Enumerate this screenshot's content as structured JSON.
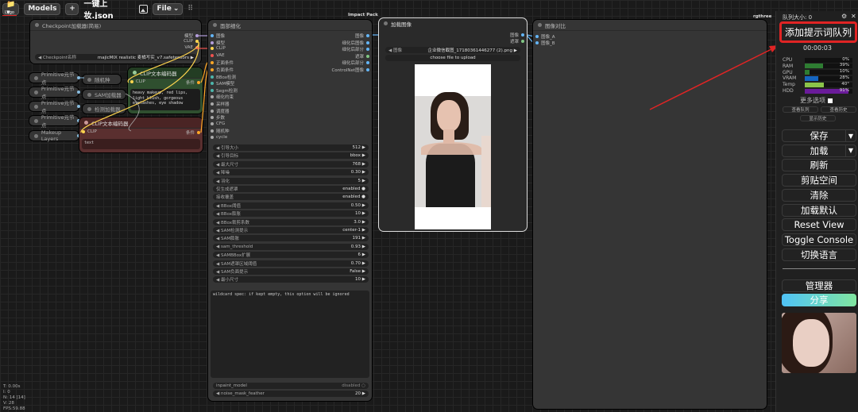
{
  "topbar": {
    "folder_label": "📁▾",
    "models_label": "Models",
    "add_label": "+",
    "workflow_title": "一键上妆.json",
    "image_icon": "image-icon",
    "file_label": "File",
    "more_label": "⠿",
    "corner_label": "Logo"
  },
  "groups": {
    "impact_pack": "Impact Pack",
    "rgthree": "rgthree"
  },
  "checkpoint_node": {
    "title": "Checkpoint加载器(简易)",
    "outputs": [
      "模型",
      "CLIP",
      "VAE"
    ],
    "ckpt_label": "Checkpoint名称",
    "ckpt_value": "majicMIX realistic 麦橘写实_v7.safetensors"
  },
  "primitives": [
    "Primitive元节点",
    "Primitive元节点",
    "Primitive元节点",
    "Primitive元节点",
    "Makeup Layers"
  ],
  "subnodes": {
    "ckpt_sub": "随机种",
    "sam_sub": "SAM加载器",
    "detector_sub": "检测加载器"
  },
  "clip_node_1": {
    "title": "CLIP文本编码器",
    "input": "CLIP",
    "output": "条件",
    "text": "heavy makeup, red lips, light blush, gorgeous eyelashes, eye shadow"
  },
  "clip_node_2": {
    "title": "CLIP文本编码器",
    "input": "CLIP",
    "output": "条件",
    "text": "text"
  },
  "detailer": {
    "title": "面部细化",
    "inputs": [
      "图像",
      "模型",
      "CLIP",
      "VAE",
      "正面条件",
      "负面条件",
      "BBox检测",
      "SAM模型",
      "Segm检测",
      "细化约束",
      "采样器",
      "调度器",
      "步数",
      "CFG",
      "随机种",
      "cycle"
    ],
    "outputs": [
      "图像",
      "细化后图像",
      "细化后部分",
      "遮罩",
      "细化后部分",
      "ControlNet图像"
    ],
    "widgets": [
      {
        "label": "引导大小",
        "value": "512"
      },
      {
        "label": "引导目标",
        "value": "bbox"
      },
      {
        "label": "最大尺寸",
        "value": "768"
      },
      {
        "label": "降噪",
        "value": "0.30"
      },
      {
        "label": "羽化",
        "value": "5"
      },
      {
        "label": "仅生成遮罩",
        "value": "enabled"
      },
      {
        "label": "接收覆盖",
        "value": "enabled"
      },
      {
        "label": "BBox阈值",
        "value": "0.50"
      },
      {
        "label": "BBox膨胀",
        "value": "10"
      },
      {
        "label": "BBox裁剪系数",
        "value": "3.0"
      },
      {
        "label": "SAM检测提示",
        "value": "center-1"
      },
      {
        "label": "SAM膨胀",
        "value": "191"
      },
      {
        "label": "sam_threshold",
        "value": "0.93"
      },
      {
        "label": "SAMBBox扩展",
        "value": "6"
      },
      {
        "label": "SAM遮罩区域阈值",
        "value": "0.70"
      },
      {
        "label": "SAM负面提示",
        "value": "False"
      },
      {
        "label": "最小尺寸",
        "value": "10"
      }
    ],
    "wildcard_placeholder": "wildcard spec: if kept empty, this option will be ignored",
    "bottom_widgets": [
      {
        "label": "inpaint_model",
        "value": "disabled"
      },
      {
        "label": "noise_mask_feather",
        "value": "20"
      }
    ]
  },
  "load_image": {
    "title": "加载图像",
    "outputs": [
      "图像",
      "遮罩"
    ],
    "image_label": "图像",
    "image_value": "企业微信截图_17180361446277 (2).png",
    "upload_label": "choose file to upload"
  },
  "compare": {
    "title": "图像对比",
    "inputs": [
      "图像_A",
      "图像_B"
    ]
  },
  "panel": {
    "queue_title": "队列大小: 0",
    "queue_button": "添加提示词队列",
    "timer": "00:00:03",
    "stats": [
      {
        "label": "CPU",
        "value": 0,
        "text": "0%",
        "color": "#2e7d32"
      },
      {
        "label": "RAM",
        "value": 39,
        "text": "39%",
        "color": "#2e7d32"
      },
      {
        "label": "GPU",
        "value": 10,
        "text": "10%",
        "color": "#2e7d32"
      },
      {
        "label": "VRAM",
        "value": 28,
        "text": "28%",
        "color": "#1565c0"
      },
      {
        "label": "Temp",
        "value": 40,
        "text": "40°",
        "color": "#8bc34a"
      },
      {
        "label": "HDD",
        "value": 91,
        "text": "91%",
        "color": "#6a1b9a"
      }
    ],
    "more_options": "更多选项",
    "view_queue": "查看队列",
    "view_history": "查看历史",
    "show_history": "显示历史",
    "buttons": [
      "保存",
      "加载",
      "刷新",
      "剪贴空间",
      "清除",
      "加载默认",
      "Reset View",
      "Toggle Console",
      "切换语言"
    ],
    "manager": "管理器",
    "share": "分享"
  },
  "status_lines": [
    "T: 0.00s",
    "I: 0",
    "N: 14 [14]",
    "V: 28",
    "FPS:59.88"
  ],
  "colors": {
    "accent_red": "#e02424",
    "share_gradient_start": "#4fc3f7",
    "share_gradient_end": "#81e6a0"
  }
}
